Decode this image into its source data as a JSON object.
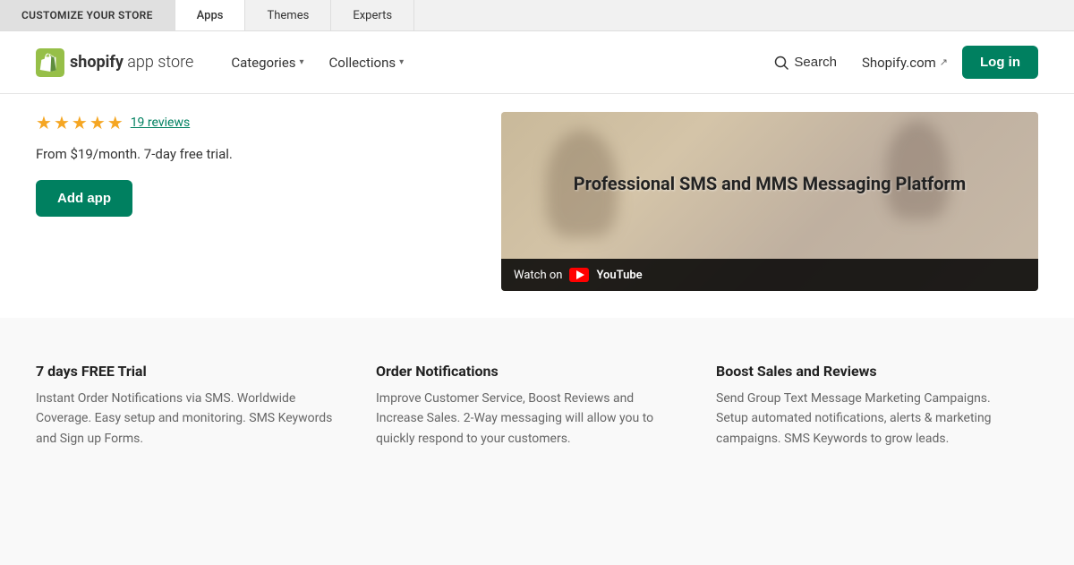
{
  "topNav": {
    "items": [
      {
        "label": "CUSTOMIZE YOUR STORE",
        "active": false
      },
      {
        "label": "Apps",
        "active": true
      },
      {
        "label": "Themes",
        "active": false
      },
      {
        "label": "Experts",
        "active": false
      }
    ]
  },
  "header": {
    "logoTextBold": "shopify",
    "logoTextLight": " app store",
    "navLinks": [
      {
        "label": "Categories",
        "hasChevron": true
      },
      {
        "label": "Collections",
        "hasChevron": true
      }
    ],
    "searchLabel": "Search",
    "shopifyLinkLabel": "Shopify.com",
    "loginLabel": "Log in"
  },
  "appDetail": {
    "reviewsText": "19 reviews",
    "pricingText": "From $19/month. 7-day free trial.",
    "addAppLabel": "Add app",
    "videoTitle": "Professional SMS and MMS Messaging Platform",
    "watchOnLabel": "Watch on",
    "youtubeLabel": "YouTube"
  },
  "features": [
    {
      "title": "7 days FREE Trial",
      "description": "Instant Order Notifications via SMS. Worldwide Coverage. Easy setup and monitoring. SMS Keywords and Sign up Forms."
    },
    {
      "title": "Order Notifications",
      "description": "Improve Customer Service, Boost Reviews and Increase Sales. 2-Way messaging will allow you to quickly respond to your customers."
    },
    {
      "title": "Boost Sales and Reviews",
      "description": "Send Group Text Message Marketing Campaigns. Setup automated notifications, alerts & marketing campaigns. SMS Keywords to grow leads."
    }
  ],
  "colors": {
    "green": "#008060",
    "starColor": "#f5a623",
    "reviewLinkColor": "#008060"
  }
}
